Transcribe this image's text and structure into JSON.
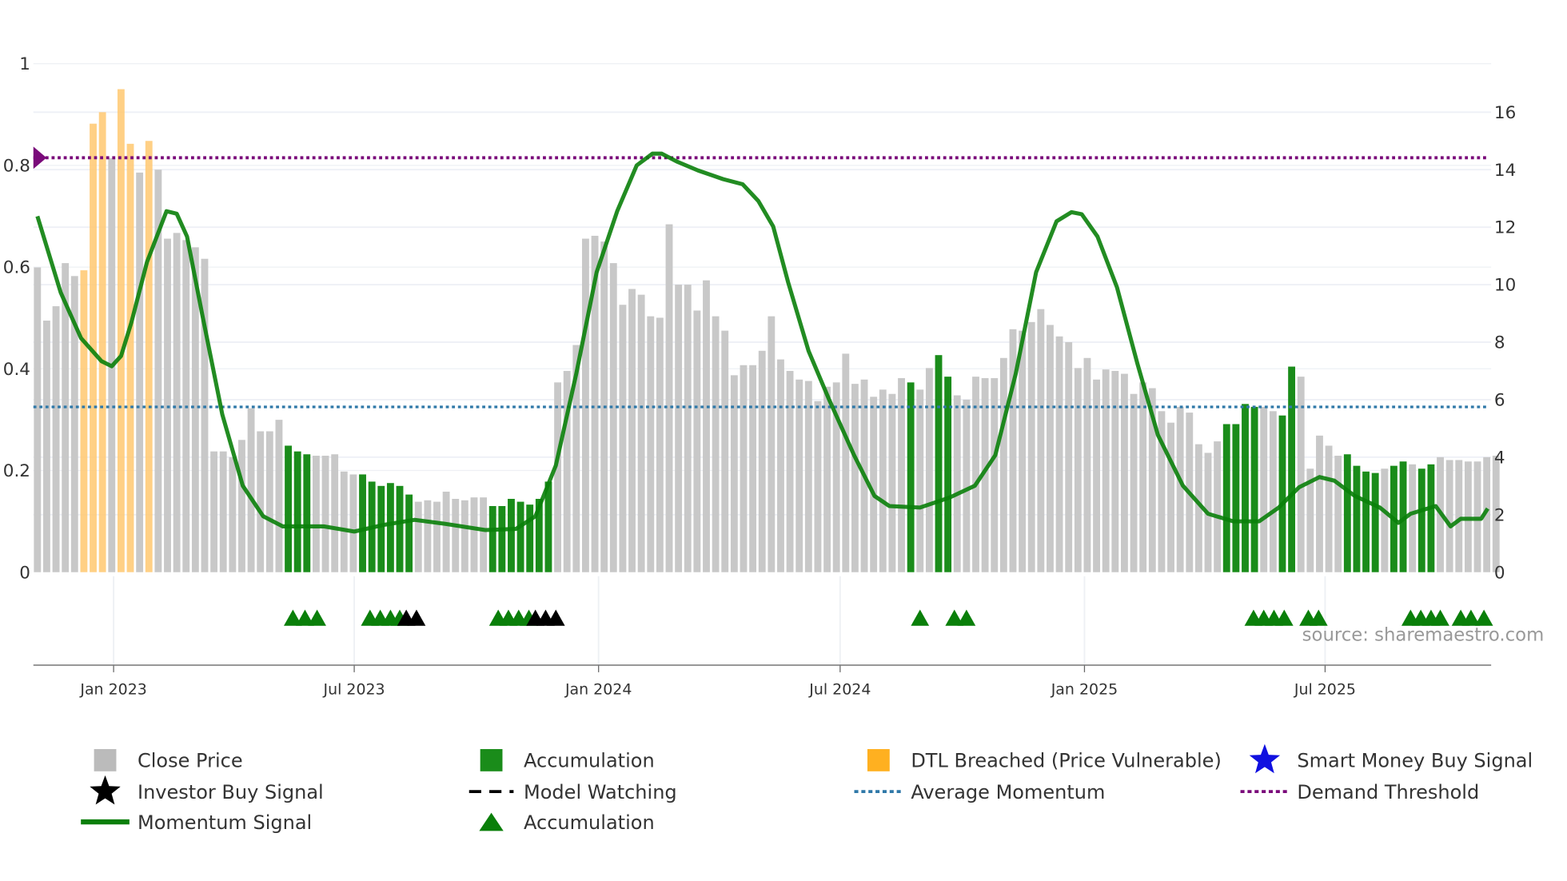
{
  "chart_data": {
    "type": "bar",
    "title": "",
    "x_unit": "week index (weekly bars, approx. Nov 2022 – Nov 2025)",
    "x_tick_labels": [
      {
        "label": "Jan 2023",
        "week": 8.2
      },
      {
        "label": "Jul 2023",
        "week": 34.1
      },
      {
        "label": "Jan 2024",
        "week": 60.4
      },
      {
        "label": "Jul 2024",
        "week": 86.4
      },
      {
        "label": "Jan 2025",
        "week": 112.7
      },
      {
        "label": "Jul 2025",
        "week": 138.6
      }
    ],
    "left_axis": {
      "ticks": [
        "0",
        "0.2",
        "0.4",
        "0.6",
        "0.8",
        "1"
      ],
      "range": [
        0,
        1
      ]
    },
    "right_axis": {
      "ticks": [
        "0",
        "2",
        "4",
        "6",
        "8",
        "10",
        "12",
        "14",
        "16"
      ],
      "range": [
        0,
        17.7
      ]
    },
    "price_bars": {
      "values": [
        10.6,
        8.75,
        9.25,
        10.75,
        10.3,
        10.5,
        15.6,
        16.0,
        14.4,
        16.8,
        14.9,
        13.9,
        15.0,
        14.0,
        11.6,
        11.8,
        11.55,
        11.3,
        10.9,
        4.2,
        4.2,
        4.0,
        4.6,
        5.7,
        4.9,
        4.9,
        5.3,
        4.4,
        4.2,
        4.1,
        4.05,
        4.05,
        4.1,
        3.5,
        3.4,
        3.4,
        3.15,
        3.0,
        3.1,
        3.0,
        2.7,
        2.45,
        2.5,
        2.45,
        2.8,
        2.55,
        2.5,
        2.6,
        2.6,
        2.3,
        2.3,
        2.55,
        2.45,
        2.35,
        2.55,
        3.15,
        6.6,
        7.0,
        7.9,
        11.6,
        11.7,
        11.5,
        10.75,
        9.3,
        9.85,
        9.65,
        8.9,
        8.85,
        12.1,
        10.0,
        10.0,
        9.1,
        10.15,
        8.9,
        8.4,
        6.85,
        7.2,
        7.2,
        7.7,
        8.9,
        7.4,
        7.0,
        6.7,
        6.65,
        5.95,
        6.45,
        6.6,
        7.6,
        6.55,
        6.7,
        6.1,
        6.35,
        6.2,
        6.75,
        6.6,
        6.35,
        7.1,
        7.55,
        6.8,
        6.15,
        6.0,
        6.8,
        6.75,
        6.75,
        7.45,
        8.45,
        8.4,
        8.7,
        9.15,
        8.6,
        8.2,
        8.0,
        7.1,
        7.45,
        6.7,
        7.05,
        7.0,
        6.9,
        6.2,
        6.6,
        6.4,
        5.6,
        5.2,
        5.75,
        5.55,
        4.45,
        4.15,
        4.55,
        5.15,
        5.15,
        5.85,
        5.75,
        5.75,
        5.6,
        5.45,
        7.15,
        6.8,
        3.6,
        4.75,
        4.4,
        4.05,
        4.1,
        3.7,
        3.5,
        3.45,
        3.6,
        3.7,
        3.85,
        3.75,
        3.6,
        3.75,
        4.0,
        3.9,
        3.9,
        3.85,
        3.85,
        4.0,
        4.05
      ],
      "types": "cccccdddcddcdccccccccccccccaaacccccaaaaaaccccccccaaaaaaaccccccccccccccccccccccccccccccccccccccaccaacccccccccccccccccccccccccccccaaaaccaacccccaaaacaacaa"
    },
    "momentum_signal": [
      [
        0,
        0.7
      ],
      [
        2.5,
        0.55
      ],
      [
        4.7,
        0.46
      ],
      [
        6.9,
        0.415
      ],
      [
        8,
        0.405
      ],
      [
        9.0,
        0.425
      ],
      [
        10.1,
        0.49
      ],
      [
        11.8,
        0.61
      ],
      [
        13.9,
        0.71
      ],
      [
        15.0,
        0.705
      ],
      [
        16.1,
        0.66
      ],
      [
        17.7,
        0.51
      ],
      [
        19.9,
        0.31
      ],
      [
        22.1,
        0.17
      ],
      [
        24.3,
        0.11
      ],
      [
        26.4,
        0.09
      ],
      [
        30.8,
        0.09
      ],
      [
        34.1,
        0.08
      ],
      [
        37.3,
        0.093
      ],
      [
        40.6,
        0.103
      ],
      [
        43.9,
        0.095
      ],
      [
        48.2,
        0.083
      ],
      [
        51.5,
        0.085
      ],
      [
        53.6,
        0.11
      ],
      [
        55.8,
        0.21
      ],
      [
        58.0,
        0.39
      ],
      [
        60.2,
        0.59
      ],
      [
        62.4,
        0.71
      ],
      [
        64.5,
        0.8
      ],
      [
        66.2,
        0.823
      ],
      [
        67.2,
        0.823
      ],
      [
        68.9,
        0.807
      ],
      [
        71.1,
        0.79
      ],
      [
        73.8,
        0.773
      ],
      [
        75.9,
        0.763
      ],
      [
        77.6,
        0.73
      ],
      [
        79.2,
        0.68
      ],
      [
        80.8,
        0.57
      ],
      [
        83.0,
        0.435
      ],
      [
        85.2,
        0.34
      ],
      [
        87.9,
        0.23
      ],
      [
        90.1,
        0.15
      ],
      [
        91.7,
        0.13
      ],
      [
        95.0,
        0.127
      ],
      [
        98.2,
        0.147
      ],
      [
        100.9,
        0.17
      ],
      [
        103.1,
        0.23
      ],
      [
        105.3,
        0.39
      ],
      [
        107.5,
        0.59
      ],
      [
        109.7,
        0.69
      ],
      [
        111.3,
        0.708
      ],
      [
        112.4,
        0.704
      ],
      [
        114.1,
        0.66
      ],
      [
        116.2,
        0.56
      ],
      [
        118.4,
        0.41
      ],
      [
        120.6,
        0.27
      ],
      [
        123.3,
        0.17
      ],
      [
        126.0,
        0.115
      ],
      [
        128.7,
        0.1
      ],
      [
        131.5,
        0.1
      ],
      [
        133.6,
        0.127
      ],
      [
        135.8,
        0.167
      ],
      [
        138.0,
        0.187
      ],
      [
        139.6,
        0.18
      ],
      [
        141.8,
        0.15
      ],
      [
        144.5,
        0.127
      ],
      [
        146.5,
        0.097
      ],
      [
        147.8,
        0.115
      ],
      [
        150.5,
        0.13
      ],
      [
        152.1,
        0.09
      ],
      [
        153.2,
        0.105
      ],
      [
        155.4,
        0.105
      ],
      [
        156.1,
        0.125
      ]
    ],
    "average_momentum": 0.325,
    "demand_threshold": 0.815,
    "signal_markers": [
      {
        "type": "accumulation",
        "weeks": [
          27.5,
          28.8,
          30.1,
          35.8,
          36.9,
          38,
          39,
          49.6,
          50.7,
          51.8,
          52.9,
          95,
          98.7,
          100,
          130.9,
          132,
          133.1,
          134.2,
          136.8,
          137.9,
          147.8,
          148.9,
          150,
          151,
          153.2,
          154.3,
          155.7
        ]
      },
      {
        "type": "investor_buy",
        "weeks": [
          39.7,
          40.8,
          53.6,
          54.7,
          55.8
        ]
      }
    ],
    "colors": {
      "close": "#c8c8c8",
      "accum": "#1a8c1a",
      "dtl": "#ffc870",
      "momentum": "#0a7f0a",
      "avg": "#2f78a8",
      "threshold": "#7a0a7a",
      "star": "#1010e0"
    },
    "legend": [
      {
        "label": "Close Price",
        "icon": "gray-square"
      },
      {
        "label": "Accumulation",
        "icon": "green-square"
      },
      {
        "label": "DTL Breached (Price Vulnerable)",
        "icon": "orange-square"
      },
      {
        "label": "Smart Money Buy Signal",
        "icon": "blue-star"
      },
      {
        "label": "Investor Buy Signal",
        "icon": "black-star"
      },
      {
        "label": "Model Watching",
        "icon": "black-dash"
      },
      {
        "label": "Average Momentum",
        "icon": "blue-dot-line"
      },
      {
        "label": "Demand Threshold",
        "icon": "purple-dot-line"
      },
      {
        "label": "Momentum Signal",
        "icon": "green-line"
      },
      {
        "label": "Accumulation",
        "icon": "green-triangle"
      }
    ],
    "legend_placement": "bottom",
    "source": "source: sharemaestro.com"
  }
}
